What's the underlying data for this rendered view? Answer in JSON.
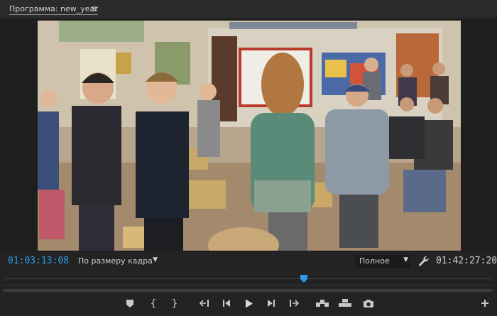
{
  "panel": {
    "title": "Программа: new_year",
    "menu_glyph": "≡"
  },
  "playback": {
    "current_timecode": "01:03:13:08",
    "fit_label": "По размеру кадра",
    "quality_label": "Полное",
    "duration_timecode": "01:42:27:20",
    "playhead_position": 0.615
  },
  "transport": {
    "mark_in_glyph": "{",
    "mark_out_glyph": "}",
    "icons": [
      "marker-icon",
      "mark-in-icon",
      "mark-out-icon",
      "go-to-in-icon",
      "step-back-icon",
      "play-icon",
      "step-forward-icon",
      "go-to-out-icon",
      "insert-icon",
      "overwrite-icon",
      "export-frame-icon",
      "add-button-icon"
    ]
  },
  "colors": {
    "accent": "#2d9ae8",
    "panel_bg": "#232323"
  }
}
